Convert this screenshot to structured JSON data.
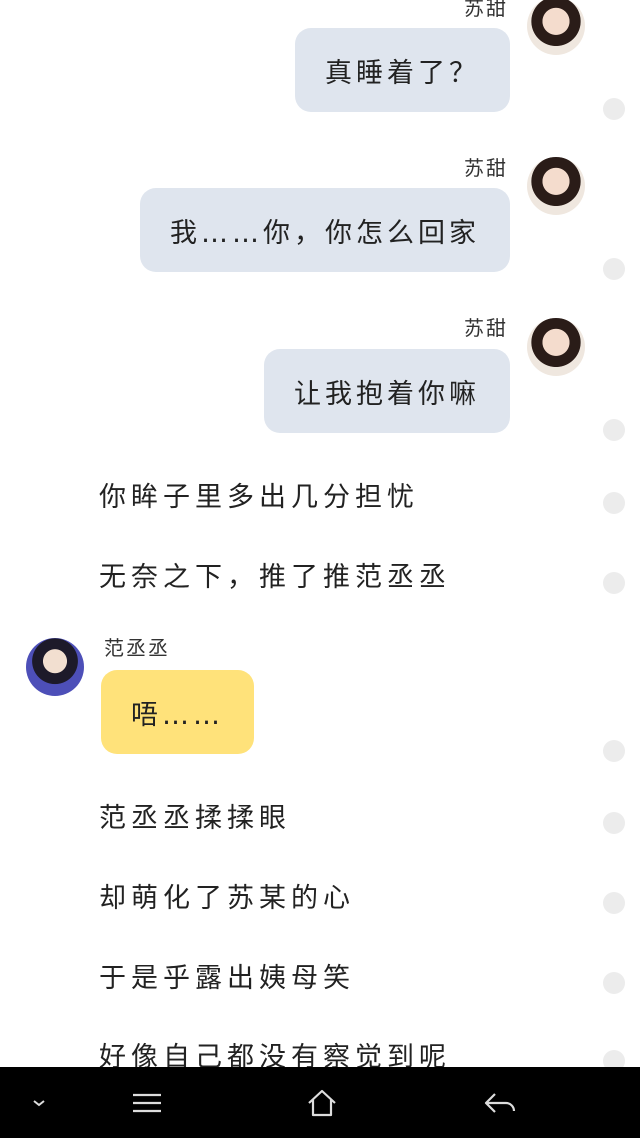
{
  "messages": [
    {
      "sender": "苏甜",
      "text": "真睡着了？"
    },
    {
      "sender": "苏甜",
      "text": "我……你，你怎么回家"
    },
    {
      "sender": "苏甜",
      "text": "让我抱着你嘛"
    }
  ],
  "narration": [
    "你眸子里多出几分担忧",
    "无奈之下，推了推范丞丞"
  ],
  "reply": {
    "sender": "范丞丞",
    "text": "唔……"
  },
  "narration2": [
    "范丞丞揉揉眼",
    "却萌化了苏某的心",
    "于是乎露出姨母笑",
    "好像自己都没有察觉到呢"
  ],
  "colors": {
    "right_bubble": "#dfe5ee",
    "left_bubble": "#ffe27a",
    "navbar": "#000000"
  },
  "icons": {
    "nav": [
      "chevron-down-icon",
      "menu-icon",
      "home-icon",
      "back-icon"
    ]
  }
}
